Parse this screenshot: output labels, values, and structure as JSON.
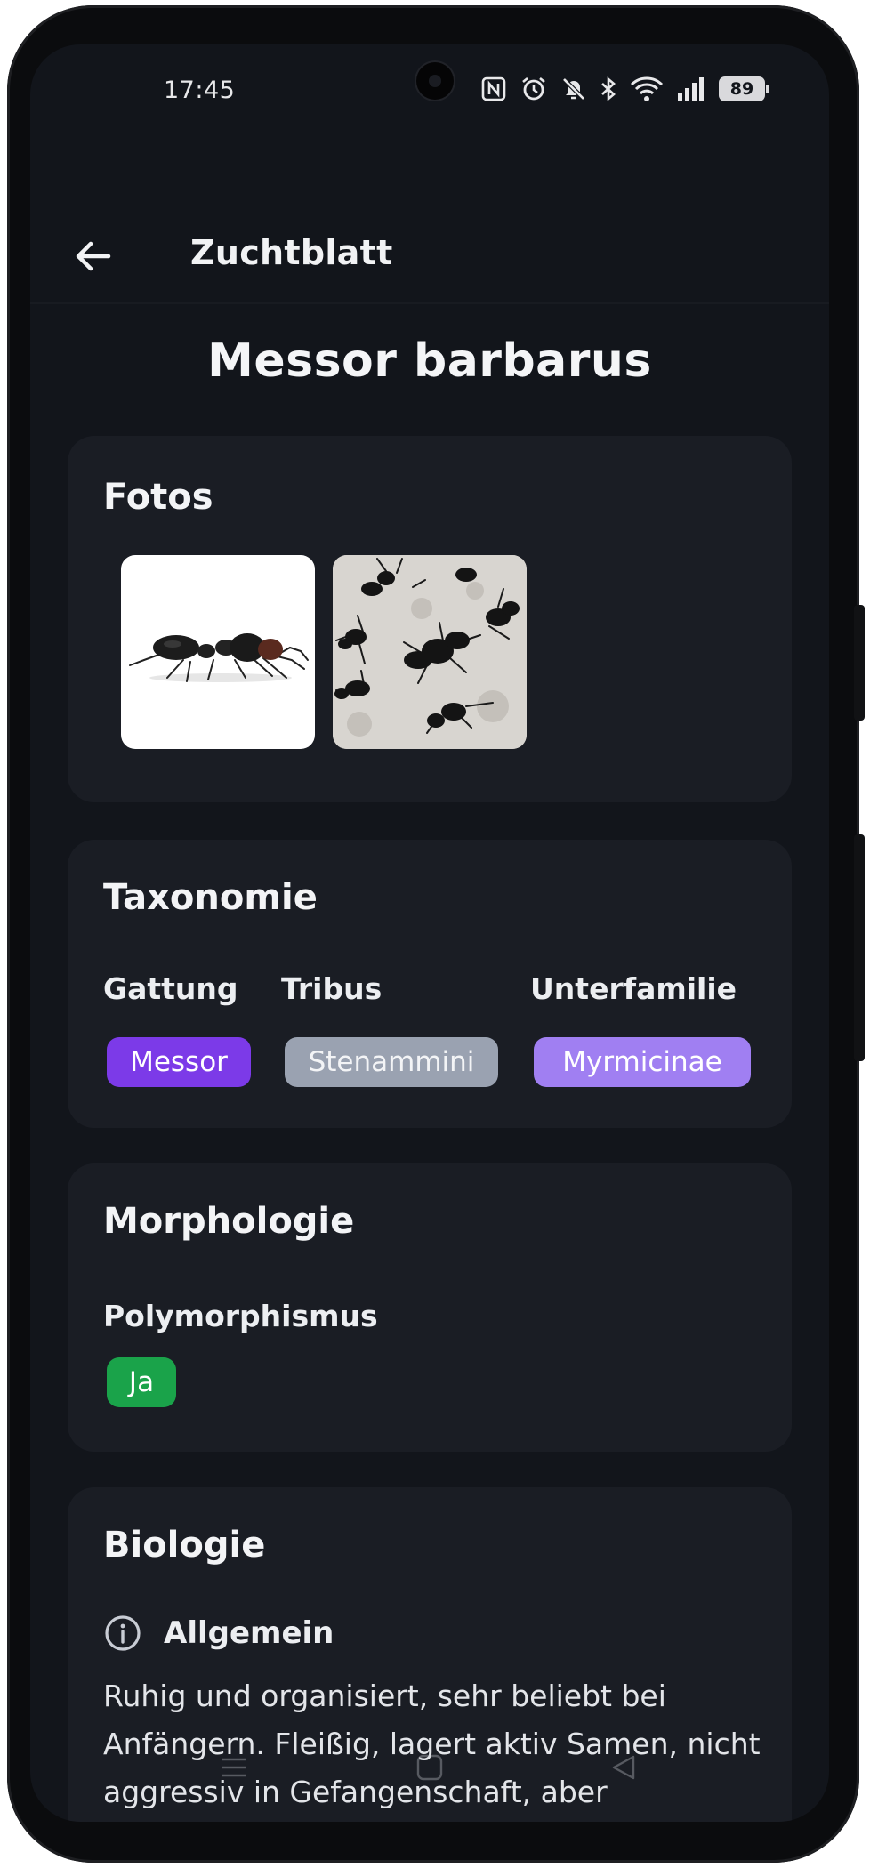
{
  "status_bar": {
    "time": "17:45",
    "battery": "89",
    "icons": [
      "nfc-icon",
      "alarm-icon",
      "mute-icon",
      "bluetooth-icon",
      "wifi-icon",
      "signal-icon",
      "battery-icon"
    ]
  },
  "app_bar": {
    "title": "Zuchtblatt",
    "back_icon": "arrow-left-icon"
  },
  "species": {
    "name": "Messor barbarus"
  },
  "fotos": {
    "title": "Fotos",
    "photos": [
      "ant-single-photo",
      "ant-group-photo"
    ]
  },
  "taxonomie": {
    "title": "Taxonomie",
    "gattung_label": "Gattung",
    "gattung_value": "Messor",
    "tribus_label": "Tribus",
    "tribus_value": "Stenammini",
    "unterfamilie_label": "Unterfamilie",
    "unterfamilie_value": "Myrmicinae",
    "colors": {
      "gattung": "#7c3ae8",
      "tribus": "#9aa2b1",
      "unterfamilie": "#a07ff2"
    }
  },
  "morphologie": {
    "title": "Morphologie",
    "polymorphismus_label": "Polymorphismus",
    "polymorphismus_value": "Ja",
    "colors": {
      "yes": "#1aa34a"
    }
  },
  "biologie": {
    "title": "Biologie",
    "allgemein_label": "Allgemein",
    "allgemein_icon": "info-icon",
    "allgemein_text": "Ruhig und organisiert, sehr beliebt bei Anfängern. Fleißig, lagert aktiv Samen, nicht aggressiv in Gefangenschaft, aber"
  },
  "nav_bar": {
    "icons": [
      "menu-icon",
      "home-icon",
      "back-triangle-icon"
    ]
  },
  "colors": {
    "background": "#12151b",
    "card": "#1a1d24",
    "text": "#f3f4f6"
  }
}
